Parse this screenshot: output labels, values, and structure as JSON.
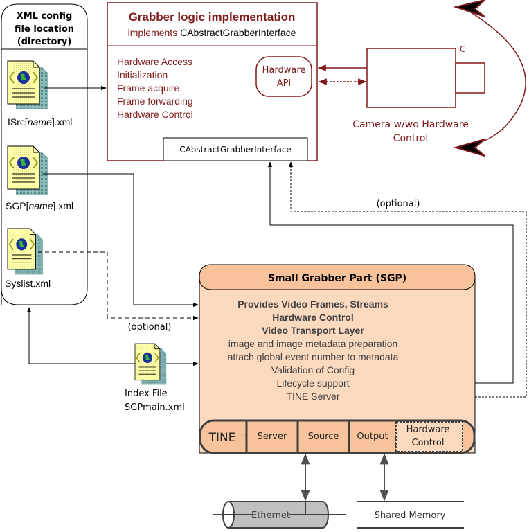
{
  "config_panel": {
    "title_lines": [
      "XML config",
      "file location",
      "(directory)"
    ],
    "files": [
      {
        "prefix": "ISrc[",
        "italic": "name",
        "suffix": "].xml"
      },
      {
        "prefix": "SGP[",
        "italic": "name",
        "suffix": "].xml"
      },
      {
        "prefix": "Syslist.xml",
        "italic": "",
        "suffix": ""
      }
    ]
  },
  "grabber_logic": {
    "title": "Grabber logic implementation",
    "subtitle_prefix": "implements",
    "subtitle_interface": "CAbstractGrabberInterface",
    "features": [
      "Hardware Access",
      "Initialization",
      "Frame acquire",
      "Frame forwarding",
      "Hardware Control"
    ],
    "hardware_api_lines": [
      "Hardware",
      "API"
    ],
    "interface_box": "CAbstractGrabberInterface"
  },
  "camera": {
    "corner_label": "C",
    "caption_lines": [
      "Camera w/wo Hardware",
      "Control"
    ]
  },
  "connectors": {
    "optional_top": "(optional)",
    "optional_left": "(optional)"
  },
  "index_file": {
    "lines": [
      "Index File",
      "SGPmain.xml"
    ]
  },
  "sgp": {
    "title": "Small Grabber Part (SGP)",
    "bold_lines": [
      "Provides Video Frames, Streams",
      "Hardware Control",
      "Video Transport Layer"
    ],
    "lines": [
      "image and image metadata preparation",
      "attach global event number to metadata",
      "Validation of Config",
      "Lifecycle support",
      "TINE Server"
    ],
    "bar": {
      "label": "TINE",
      "cells": [
        "Server",
        "Source",
        "Output"
      ],
      "hw_cell_lines": [
        "Hardware",
        "Control"
      ]
    }
  },
  "ethernet": {
    "label": "Ethernet"
  },
  "shared_memory": {
    "label": "Shared Memory"
  },
  "colors": {
    "accent_red": "#7f1919",
    "sgp_fill": "#fad9bf",
    "sgp_header": "#f8c39b",
    "bar_stroke": "#404040",
    "ethernet_fill": "#c0c0c0"
  }
}
